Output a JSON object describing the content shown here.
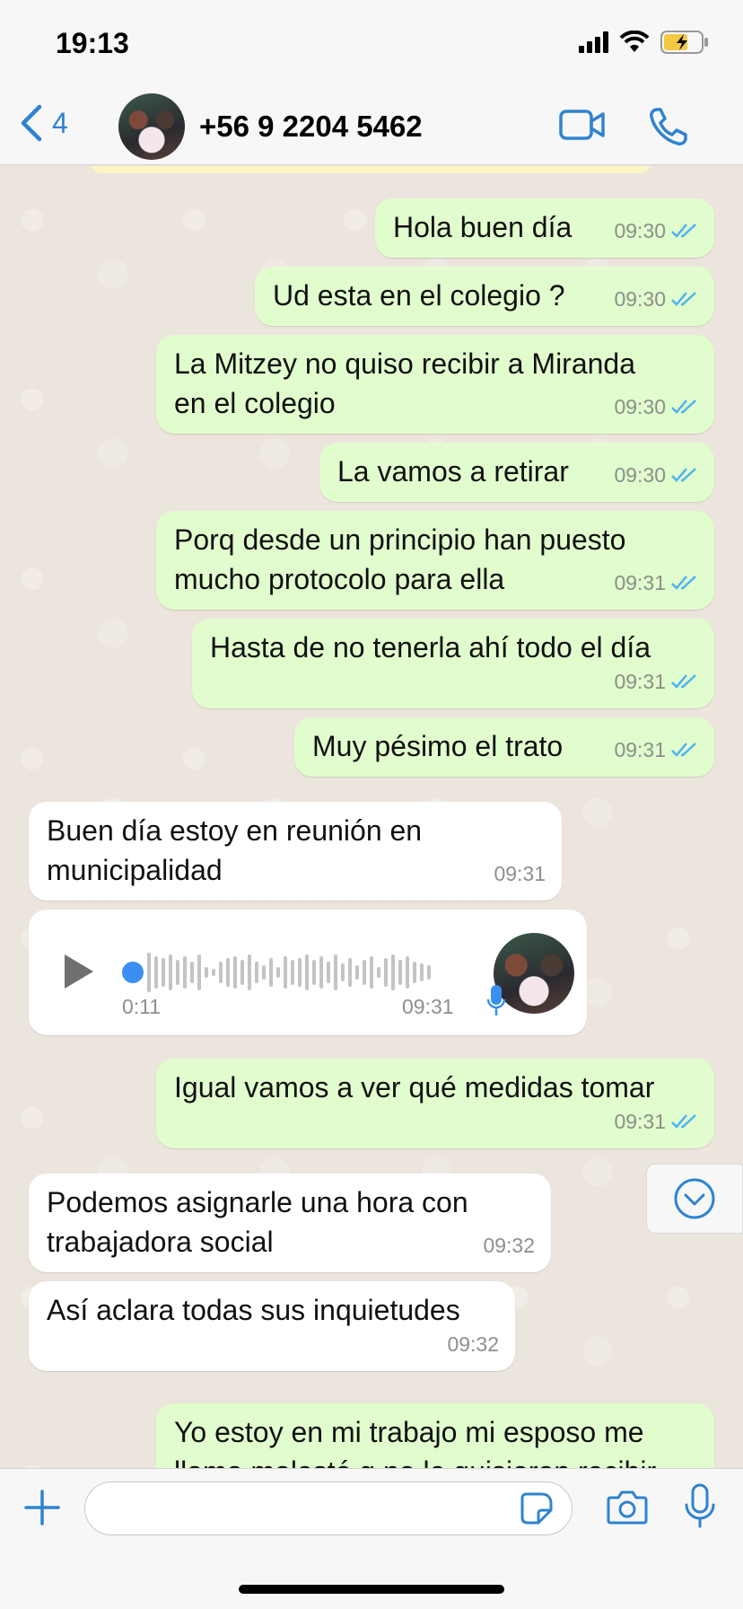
{
  "status_bar": {
    "time": "19:13"
  },
  "header": {
    "back_count": "4",
    "contact_name": "+56 9 2204 5462"
  },
  "messages": [
    {
      "text": "Hola buen día",
      "time": "09:30"
    },
    {
      "text": "Ud esta en el colegio ?",
      "time": "09:30"
    },
    {
      "line1": "La Mitzey no quiso recibir a Miranda",
      "line2": "en el colegio",
      "time": "09:30"
    },
    {
      "text": "La vamos a retirar",
      "time": "09:30"
    },
    {
      "line1": "Porq desde un principio han puesto",
      "line2": "mucho protocolo para ella",
      "time": "09:31"
    },
    {
      "text": "Hasta de no tenerla ahí todo el día",
      "time": "09:31"
    },
    {
      "text": "Muy pésimo el trato",
      "time": "09:31"
    },
    {
      "line1": "Buen día estoy en reunión en",
      "line2": "municipalidad",
      "time": "09:31"
    },
    {
      "duration": "0:11",
      "time": "09:31"
    },
    {
      "text": "Igual vamos a ver qué medidas  tomar",
      "time": "09:31"
    },
    {
      "line1": "Podemos asignarle una hora con",
      "line2": "trabajadora social",
      "time": "09:32"
    },
    {
      "text": "Así aclara todas sus inquietudes",
      "time": "09:32"
    },
    {
      "line1": "Yo estoy en mi trabajo mi esposo me",
      "line2": "llamo molestó q no le quisieron recibir"
    }
  ],
  "colors": {
    "outgoing": "#e2fdcd",
    "incoming": "#ffffff",
    "accent": "#2f83d0",
    "read_ticks": "#4fb3f0"
  },
  "icons": [
    "back-chevron-icon",
    "video-call-icon",
    "phone-icon",
    "plus-icon",
    "sticker-icon",
    "camera-icon",
    "microphone-icon",
    "chevron-down-icon"
  ]
}
